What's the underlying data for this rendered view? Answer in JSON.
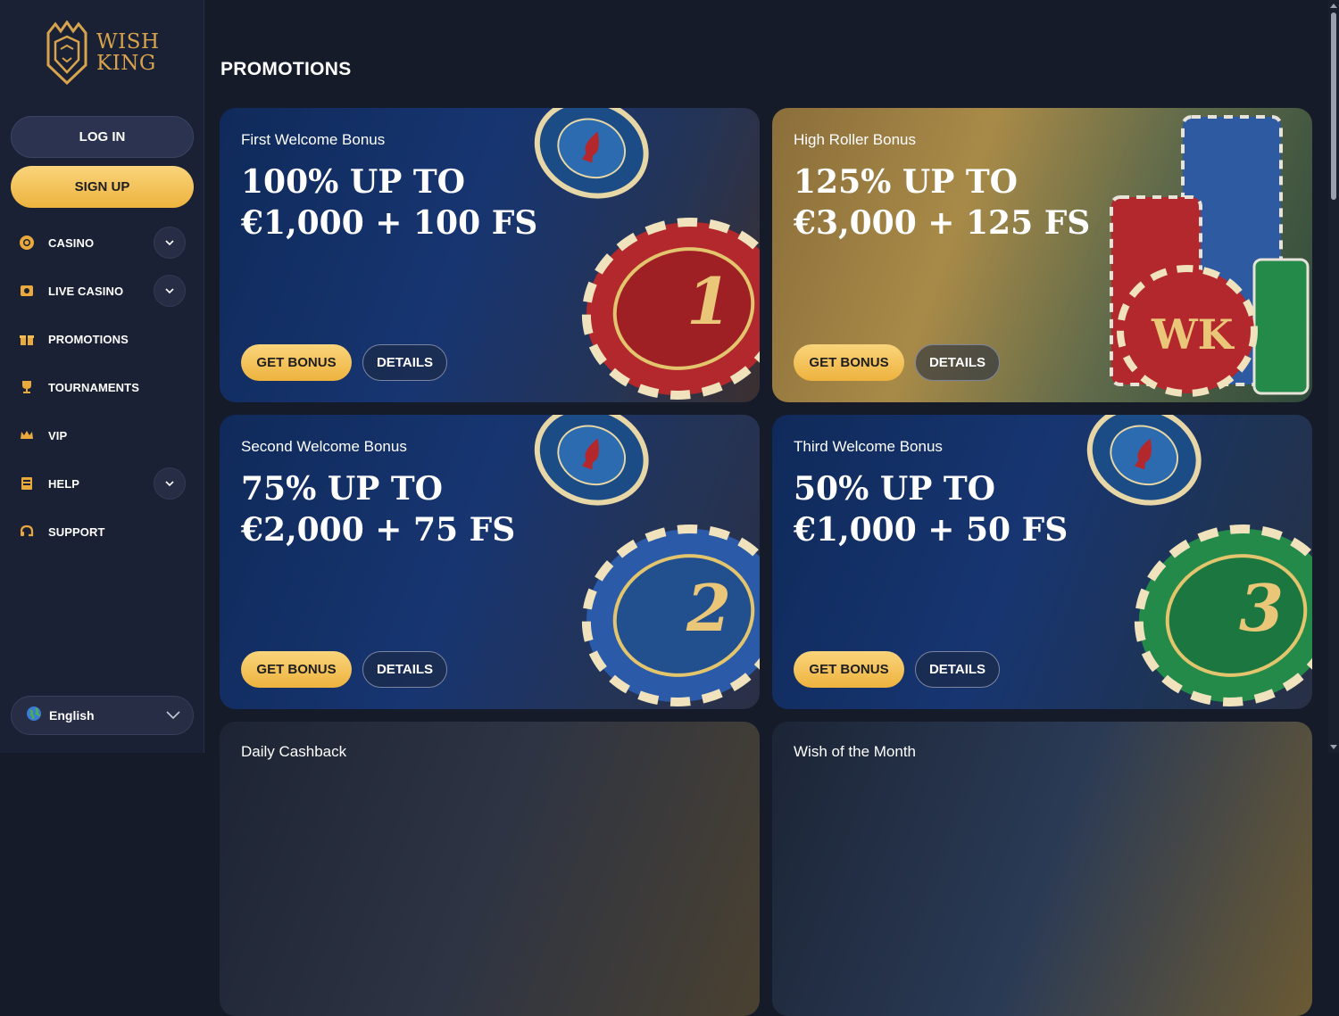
{
  "brand": {
    "name_line1": "WISH",
    "name_line2": "KING",
    "gold": "#d7a44d"
  },
  "auth": {
    "login_label": "LOG IN",
    "signup_label": "SIGN UP"
  },
  "nav": [
    {
      "label": "CASINO",
      "icon": "chip-icon",
      "expandable": true
    },
    {
      "label": "LIVE CASINO",
      "icon": "live-dealer-icon",
      "expandable": true
    },
    {
      "label": "PROMOTIONS",
      "icon": "gift-icon",
      "expandable": false
    },
    {
      "label": "TOURNAMENTS",
      "icon": "trophy-icon",
      "expandable": false
    },
    {
      "label": "VIP",
      "icon": "crown-icon",
      "expandable": false
    },
    {
      "label": "HELP",
      "icon": "help-book-icon",
      "expandable": true
    },
    {
      "label": "SUPPORT",
      "icon": "support-chat-icon",
      "expandable": false
    }
  ],
  "language": {
    "selected": "English",
    "icon": "globe-icon"
  },
  "page": {
    "title": "PROMOTIONS"
  },
  "promos": [
    {
      "subtitle": "First Welcome Bonus",
      "line1": "100% UP TO",
      "line2": "€1,000 + 100 FS",
      "get_label": "GET BONUS",
      "details_label": "DETAILS",
      "chip_color": "#b3282c",
      "chip_text": "1",
      "theme": "blue"
    },
    {
      "subtitle": "High Roller Bonus",
      "line1": "125% UP TO",
      "line2": "€3,000 + 125 FS",
      "get_label": "GET BONUS",
      "details_label": "DETAILS",
      "chip_color": "#b3282c",
      "chip_text": "WK",
      "theme": "gold"
    },
    {
      "subtitle": "Second Welcome Bonus",
      "line1": "75% UP TO",
      "line2": "€2,000 + 75 FS",
      "get_label": "GET BONUS",
      "details_label": "DETAILS",
      "chip_color": "#2a5aa8",
      "chip_text": "2",
      "theme": "blue"
    },
    {
      "subtitle": "Third Welcome Bonus",
      "line1": "50% UP TO",
      "line2": "€1,000 + 50 FS",
      "get_label": "GET BONUS",
      "details_label": "DETAILS",
      "chip_color": "#238a4a",
      "chip_text": "3",
      "theme": "blue"
    },
    {
      "subtitle": "Daily Cashback",
      "theme": "dark"
    },
    {
      "subtitle": "Wish of the Month",
      "theme": "dark"
    }
  ]
}
